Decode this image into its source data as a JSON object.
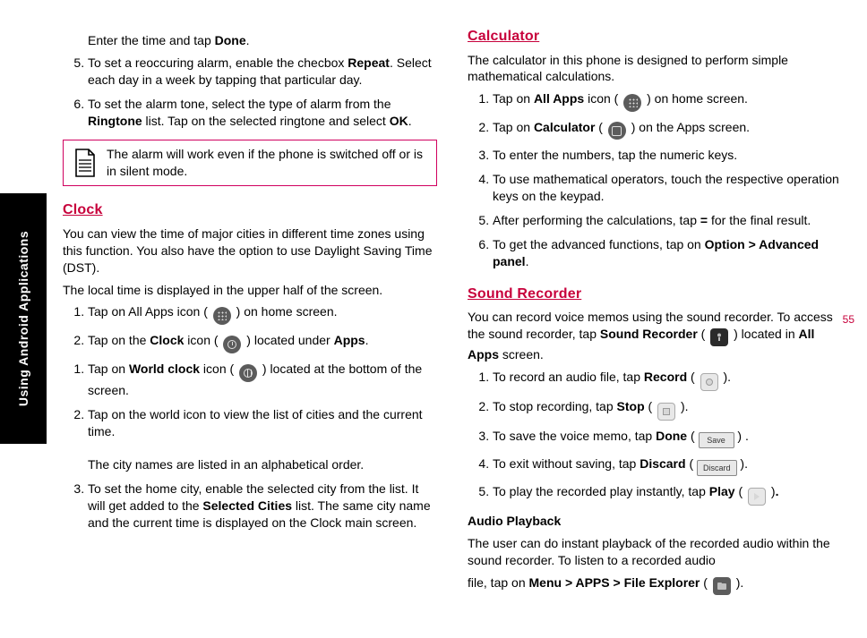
{
  "side_tab": "Using Android Applications",
  "page_number": "55",
  "left": {
    "intro_step_text": "Enter the time and tap ",
    "intro_step_done": "Done",
    "steps_a": [
      {
        "n": "5.",
        "pre": "To set a reoccuring alarm, enable the checbox ",
        "b": "Repeat",
        "post": ". Select each day in a week by tapping that particular day."
      },
      {
        "n": "6.",
        "pre": "To set the alarm tone, select the type of alarm from the ",
        "b": "Ringtone",
        "mid": " list. Tap on the selected ringtone and select ",
        "b2": "OK",
        "post": "."
      }
    ],
    "note": "The alarm will work even if the phone is switched off or is in silent mode.",
    "clock_title": "Clock",
    "clock_p1": "You can view the time of major cities in different time zones using this function. You also have the option to use Daylight Saving Time (DST).",
    "clock_p2": "The local time is displayed in the upper half of the screen.",
    "clock_steps_a": [
      {
        "n": "1.",
        "pre": "Tap on All Apps icon ( ",
        "post": " ) on home screen."
      },
      {
        "n": "2.",
        "pre": "Tap on the ",
        "b": "Clock",
        "mid": " icon ( ",
        "post": " ) located under ",
        "b2": "Apps",
        "post2": "."
      }
    ],
    "clock_steps_b": [
      {
        "n": "1.",
        "pre": "Tap on ",
        "b": "World clock",
        "mid": " icon ( ",
        "post": " ) located at the bottom of the screen."
      },
      {
        "n": "2.",
        "t": "Tap on the world icon to view the list of cities and the current time."
      },
      {
        "n": "",
        "t": "The city names are listed in an alphabetical order."
      },
      {
        "n": "3.",
        "pre": "To set the home city, enable the selected city from the list. It will get added to the ",
        "b": "Selected Cities",
        "post": " list. The same city name and the current time is displayed on the Clock main screen."
      }
    ]
  },
  "right": {
    "calc_title": "Calculator",
    "calc_intro": "The calculator in this phone is designed to perform simple mathematical calculations.",
    "calc_steps": [
      {
        "n": "1.",
        "pre": "Tap on ",
        "b": "All Apps",
        "mid": " icon ( ",
        "post": " ) on home screen."
      },
      {
        "n": "2.",
        "pre": "Tap on ",
        "b": "Calculator",
        "mid": " ( ",
        "post": " ) on the Apps screen."
      },
      {
        "n": "3.",
        "t": "To enter the numbers, tap the numeric keys."
      },
      {
        "n": "4.",
        "t": "To use mathematical operators, touch the respective operation keys on the keypad."
      },
      {
        "n": "5.",
        "pre": "After performing the calculations, tap ",
        "b": "=",
        "post": " for the final result."
      },
      {
        "n": "6.",
        "pre": "To get the advanced functions, tap on ",
        "b": "Option > Advanced panel",
        "post": "."
      }
    ],
    "sr_title": "Sound Recorder",
    "sr_intro_pre": "You can record voice memos using the sound recorder. To access the sound recorder, tap ",
    "sr_intro_b": "Sound Recorder",
    "sr_intro_mid": " ( ",
    "sr_intro_post": " ) located in ",
    "sr_intro_b2": "All Apps",
    "sr_intro_post2": " screen.",
    "sr_steps": [
      {
        "n": "1.",
        "pre": "To record an audio file, tap ",
        "b": "Record",
        "mid": " ( ",
        "post": " )."
      },
      {
        "n": "2.",
        "pre": "To stop recording, tap ",
        "b": "Stop",
        "mid": " ( ",
        "post": " )."
      },
      {
        "n": "3.",
        "pre": "To save the voice memo, tap ",
        "b": "Done",
        "mid": " ( ",
        "btn": "Save",
        "post": " ) ."
      },
      {
        "n": "4.",
        "pre": "To exit without saving, tap ",
        "b": "Discard",
        "mid": " ( ",
        "btn": "Discard",
        "post": " )."
      },
      {
        "n": "5.",
        "pre": "To play the recorded play instantly, tap ",
        "b": "Play",
        "mid": " ( ",
        "post": " )",
        "b2": "."
      }
    ],
    "audio_title": "Audio Playback",
    "audio_p": "The user can do instant playback of the recorded audio within the sound recorder. To listen to a recorded audio",
    "audio_p2_pre": "file, tap on ",
    "audio_p2_b": "Menu > APPS > File Explorer",
    "audio_p2_mid": " ( ",
    "audio_p2_post": " )."
  }
}
